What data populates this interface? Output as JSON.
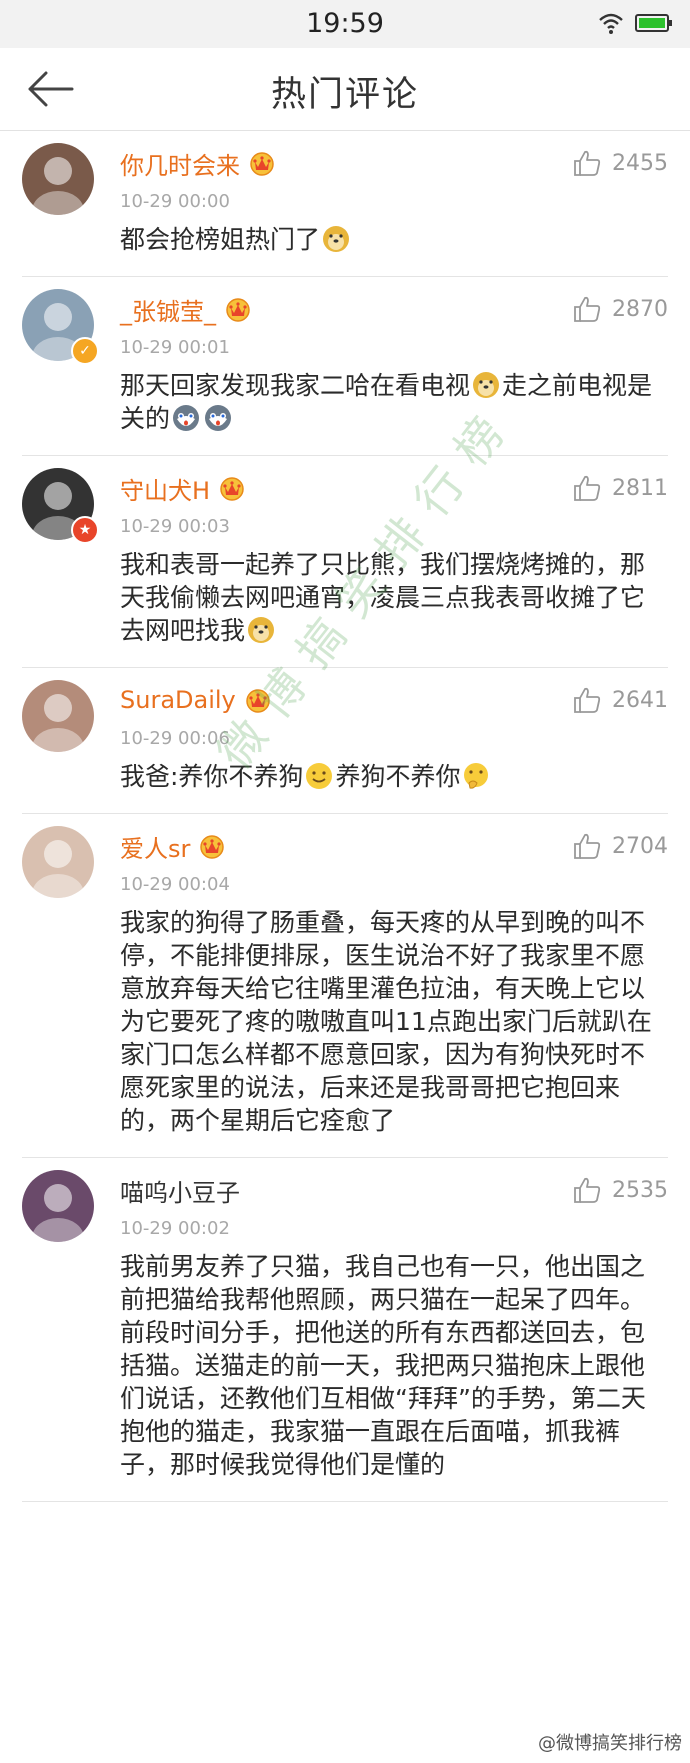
{
  "status": {
    "time": "19:59"
  },
  "nav": {
    "title": "热门评论"
  },
  "comments": [
    {
      "user": "你几时会来",
      "time": "10-29 00:00",
      "likes": "2455",
      "content": "都会抢榜姐热门了",
      "has_crown": true,
      "name_color": "#e8701f",
      "badge": "none",
      "emojis_after": [
        "doge-emoji"
      ],
      "avatar_color": "#7a5a4a"
    },
    {
      "user": "_张铖莹_",
      "time": "10-29 00:01",
      "likes": "2870",
      "content_a": "那天回家发现我家二哈在看电视",
      "content_b": "走之前电视是关的",
      "has_crown": true,
      "name_color": "#e8701f",
      "badge": "verified-yellow",
      "avatar_color": "#8aa1b5"
    },
    {
      "user": "守山犬H",
      "time": "10-29 00:03",
      "likes": "2811",
      "content": "我和表哥一起养了只比熊，我们摆烧烤摊的，那天我偷懒去网吧通宵，凌晨三点我表哥收摊了它去网吧找我",
      "has_crown": true,
      "name_color": "#e8701f",
      "badge": "verified-red",
      "avatar_color": "#333333"
    },
    {
      "user": "SuraDaily",
      "time": "10-29 00:06",
      "likes": "2641",
      "content_a": "我爸:养你不养狗",
      "content_b": "养狗不养你",
      "has_crown": true,
      "name_color": "#e8701f",
      "badge": "none",
      "avatar_color": "#b48c7a"
    },
    {
      "user": "爱人sr",
      "time": "10-29 00:04",
      "likes": "2704",
      "content": "我家的狗得了肠重叠，每天疼的从早到晚的叫不停，不能排便排尿，医生说治不好了我家里不愿意放弃每天给它往嘴里灌色拉油，有天晚上它以为它要死了疼的嗷嗷直叫11点跑出家门后就趴在家门口怎么样都不愿意回家，因为有狗快死时不愿死家里的说法，后来还是我哥哥把它抱回来的，两个星期后它痊愈了",
      "has_crown": true,
      "name_color": "#e8701f",
      "badge": "none",
      "avatar_color": "#d9c0b0"
    },
    {
      "user": "喵呜小豆子",
      "time": "10-29 00:02",
      "likes": "2535",
      "content": "我前男友养了只猫，我自己也有一只，他出国之前把猫给我帮他照顾，两只猫在一起呆了四年。前段时间分手，把他送的所有东西都送回去，包括猫。送猫走的前一天，我把两只猫抱床上跟他们说话，还教他们互相做“拜拜”的手势，第二天抱他的猫走，我家猫一直跟在后面喵，抓我裤子，那时候我觉得他们是懂的",
      "has_crown": false,
      "name_color": "#333333",
      "badge": "none",
      "avatar_color": "#6a4a6a"
    }
  ],
  "watermark": {
    "diagonal": "微博搞笑排行榜",
    "corner": "@微博搞笑排行榜"
  }
}
